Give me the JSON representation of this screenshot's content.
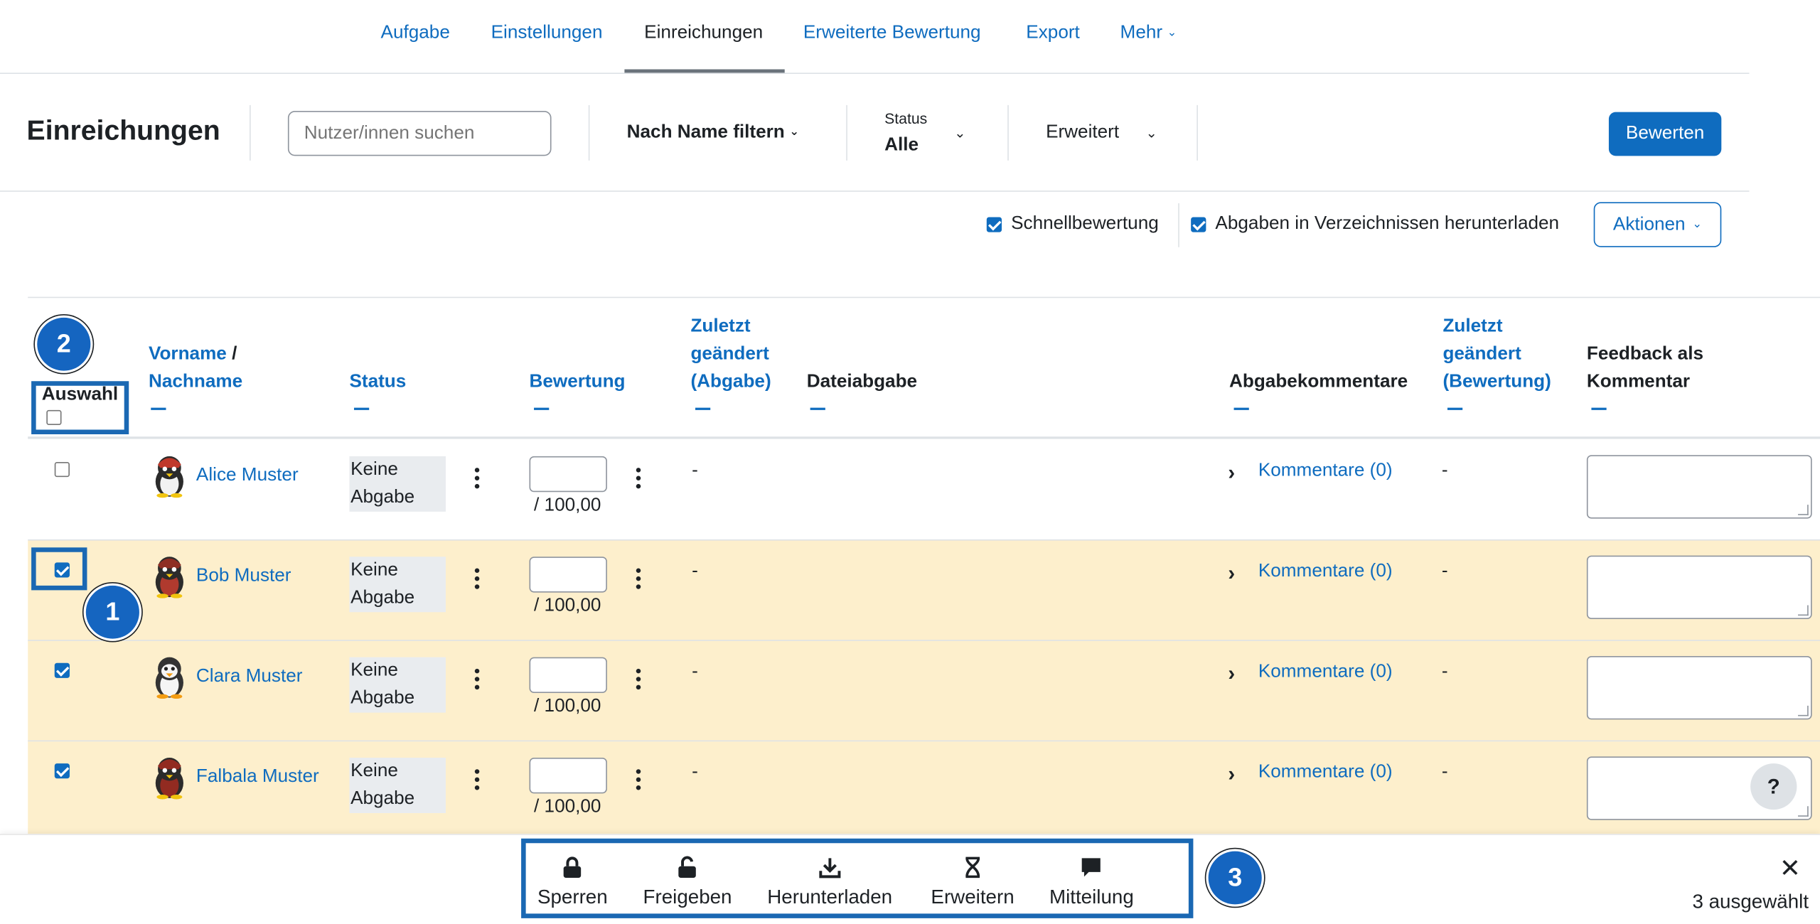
{
  "nav": {
    "tabs": [
      "Aufgabe",
      "Einstellungen",
      "Einreichungen",
      "Erweiterte Bewertung",
      "Export",
      "Mehr"
    ],
    "active": "Einreichungen"
  },
  "header": {
    "title": "Einreichungen",
    "search_placeholder": "Nutzer/innen suchen",
    "name_filter": "Nach Name filtern",
    "status_label": "Status",
    "status_value": "Alle",
    "advanced": "Erweitert",
    "grade_button": "Bewerten"
  },
  "options": {
    "quick_grading": "Schnellbewertung",
    "download_in_folders": "Abgaben in Verzeichnissen herunterladen",
    "actions_button": "Aktionen"
  },
  "table": {
    "headers": {
      "select": "Auswahl",
      "firstname": "Vorname",
      "slash": " /",
      "lastname": "Nachname",
      "status": "Status",
      "grade": "Bewertung",
      "modified_sub_1": "Zuletzt",
      "modified_sub_2": "geändert",
      "modified_sub_3": "(Abgabe)",
      "file_submission": "Dateiabgabe",
      "sub_comments": "Abgabekommentare",
      "modified_grade_1": "Zuletzt",
      "modified_grade_2": "geändert",
      "modified_grade_3": "(Bewertung)",
      "feedback_1": "Feedback als",
      "feedback_2": "Kommentar"
    },
    "rows": [
      {
        "name": "Alice Muster",
        "selected": false,
        "status_1": "Keine",
        "status_2": "Abgabe",
        "grade_max": "/ 100,00",
        "modified": "-",
        "comments": "Kommentare (0)",
        "modified_grade": "-"
      },
      {
        "name": "Bob Muster",
        "selected": true,
        "status_1": "Keine",
        "status_2": "Abgabe",
        "grade_max": "/ 100,00",
        "modified": "-",
        "comments": "Kommentare (0)",
        "modified_grade": "-"
      },
      {
        "name": "Clara Muster",
        "selected": true,
        "status_1": "Keine",
        "status_2": "Abgabe",
        "grade_max": "/ 100,00",
        "modified": "-",
        "comments": "Kommentare (0)",
        "modified_grade": "-"
      },
      {
        "name": "Falbala Muster",
        "selected": true,
        "status_1": "Keine",
        "status_2": "Abgabe",
        "grade_max": "/ 100,00",
        "modified": "-",
        "comments": "Kommentare (0)",
        "modified_grade": "-"
      }
    ]
  },
  "annotations": {
    "n1": "1",
    "n2": "2",
    "n3": "3"
  },
  "bottom_bar": {
    "lock": "Sperren",
    "unlock": "Freigeben",
    "download": "Herunterladen",
    "extend": "Erweitern",
    "message": "Mitteilung",
    "selected_count": "3 ausgewählt",
    "close": "✕"
  },
  "help": "?",
  "colors": {
    "accent": "#0f6cbf",
    "selected_row": "#fdefcc",
    "annotation": "#1565c0"
  }
}
